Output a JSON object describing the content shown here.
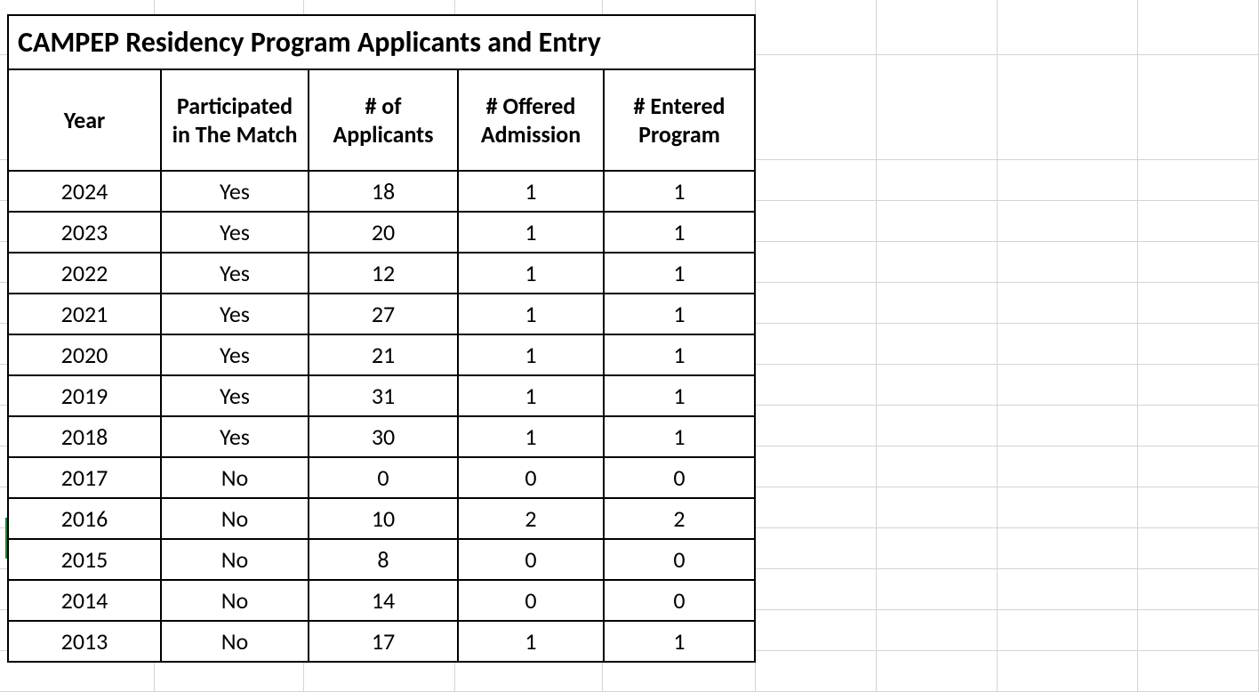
{
  "title": "CAMPEP Residency Program Applicants and Entry",
  "headers": {
    "year": "Year",
    "participated": "Participated in The Match",
    "applicants": "# of Applicants",
    "offered": "# Offered Admission",
    "entered": "# Entered Program"
  },
  "chart_data": {
    "type": "table",
    "title": "CAMPEP Residency Program Applicants and Entry",
    "columns": [
      "Year",
      "Participated in The Match",
      "# of Applicants",
      "# Offered Admission",
      "# Entered Program"
    ],
    "rows": [
      {
        "year": "2024",
        "participated": "Yes",
        "applicants": "18",
        "offered": "1",
        "entered": "1"
      },
      {
        "year": "2023",
        "participated": "Yes",
        "applicants": "20",
        "offered": "1",
        "entered": "1"
      },
      {
        "year": "2022",
        "participated": "Yes",
        "applicants": "12",
        "offered": "1",
        "entered": "1"
      },
      {
        "year": "2021",
        "participated": "Yes",
        "applicants": "27",
        "offered": "1",
        "entered": "1"
      },
      {
        "year": "2020",
        "participated": "Yes",
        "applicants": "21",
        "offered": "1",
        "entered": "1"
      },
      {
        "year": "2019",
        "participated": "Yes",
        "applicants": "31",
        "offered": "1",
        "entered": "1"
      },
      {
        "year": "2018",
        "participated": "Yes",
        "applicants": "30",
        "offered": "1",
        "entered": "1"
      },
      {
        "year": "2017",
        "participated": "No",
        "applicants": "0",
        "offered": "0",
        "entered": "0"
      },
      {
        "year": "2016",
        "participated": "No",
        "applicants": "10",
        "offered": "2",
        "entered": "2"
      },
      {
        "year": "2015",
        "participated": "No",
        "applicants": "8",
        "offered": "0",
        "entered": "0"
      },
      {
        "year": "2014",
        "participated": "No",
        "applicants": "14",
        "offered": "0",
        "entered": "0"
      },
      {
        "year": "2013",
        "participated": "No",
        "applicants": "17",
        "offered": "1",
        "entered": "1"
      }
    ]
  }
}
